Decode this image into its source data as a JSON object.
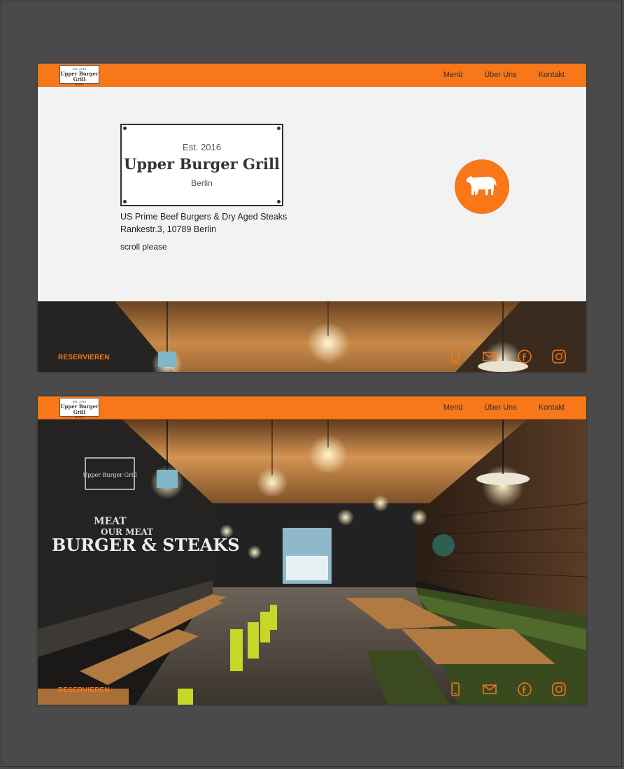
{
  "nav": {
    "logo": {
      "est": "Est. 2016",
      "name": "Upper Burger Grill",
      "city": "Berlin"
    },
    "links": [
      "Menü",
      "Über Uns",
      "Kontakt"
    ]
  },
  "hero": {
    "est": "Est. 2016",
    "title": "Upper Burger Grill",
    "city": "Berlin",
    "tagline": "US Prime Beef Burgers & Dry Aged Steaks",
    "address": "Rankestr.3, 10789 Berlin",
    "scroll": "scroll please"
  },
  "footer": {
    "reserve": "RESERVIEREN",
    "socials": [
      "phone-icon",
      "mail-icon",
      "facebook-icon",
      "instagram-icon"
    ]
  },
  "colors": {
    "accent": "#f77719",
    "background": "#f2f2f2",
    "frame": "#4a4a4a"
  }
}
